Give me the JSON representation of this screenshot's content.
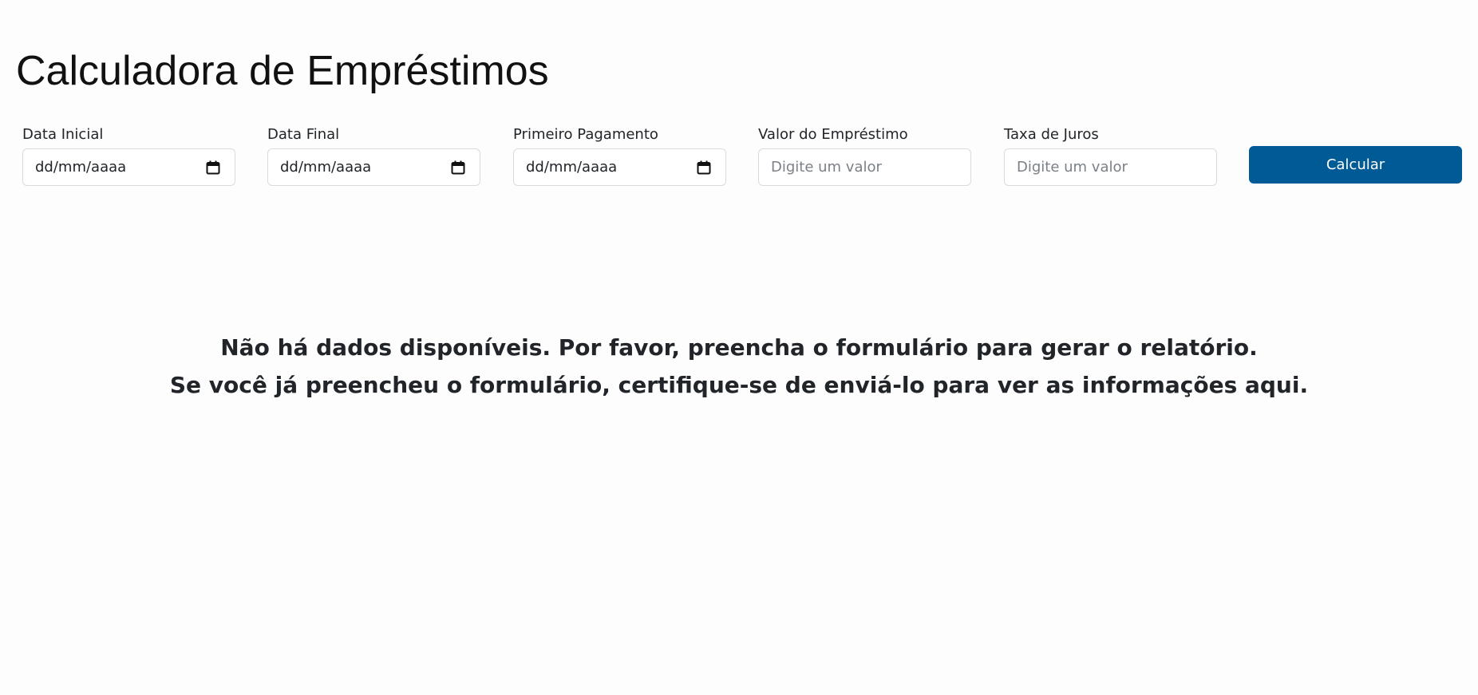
{
  "page": {
    "title": "Calculadora de Empréstimos"
  },
  "form": {
    "fields": [
      {
        "label": "Data Inicial",
        "value": "dd/mm/aaaa",
        "type": "date"
      },
      {
        "label": "Data Final",
        "value": "dd/mm/aaaa",
        "type": "date"
      },
      {
        "label": "Primeiro Pagamento",
        "value": "dd/mm/aaaa",
        "type": "date"
      },
      {
        "label": "Valor do Empréstimo",
        "value": "",
        "placeholder": "Digite um valor",
        "type": "text"
      },
      {
        "label": "Taxa de Juros",
        "value": "",
        "placeholder": "Digite um valor",
        "type": "text"
      }
    ],
    "submit_label": "Calcular",
    "calendar_icon": "calendar-icon"
  },
  "empty_state": {
    "line1": "Não há dados disponíveis. Por favor, preencha o formulário para gerar o relatório.",
    "line2": "Se você já preencheu o formulário, certifique-se de enviá-lo para ver as informações aqui."
  },
  "colors": {
    "primary": "#005a96",
    "background": "#fdfdfd",
    "border": "#d7dbe0",
    "text": "#212529"
  }
}
